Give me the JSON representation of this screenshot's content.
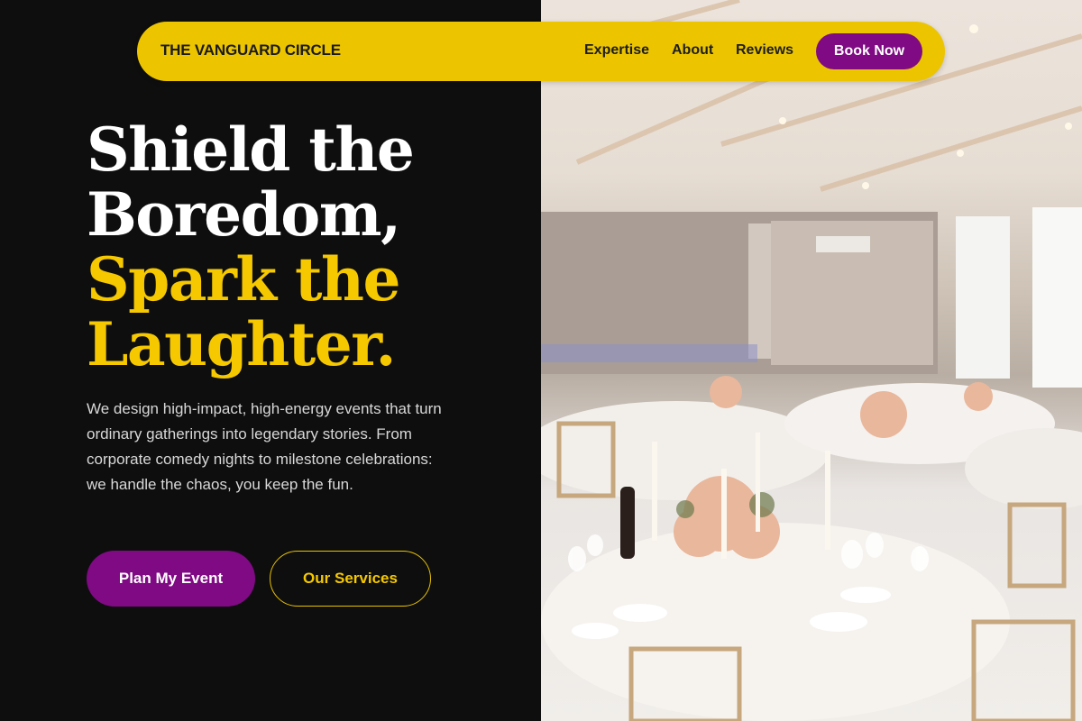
{
  "nav": {
    "brand": "THE VANGUARD CIRCLE",
    "links": [
      "Expertise",
      "About",
      "Reviews"
    ],
    "cta": "Book Now"
  },
  "hero": {
    "headline_line1": "Shield the",
    "headline_line2": "Boredom,",
    "headline_line3": "Spark the",
    "headline_line4": "Laughter.",
    "description": "We design high-impact, high-energy events that turn ordinary gatherings into legendary stories. From corporate comedy nights to milestone celebrations: we handle the chaos, you keep the fun.",
    "primary_button": "Plan My Event",
    "secondary_button": "Our Services"
  },
  "colors": {
    "background": "#0e0e0f",
    "accent_yellow": "#ecc500",
    "accent_purple": "#7f0a83",
    "headline_gold": "#f5c800"
  }
}
